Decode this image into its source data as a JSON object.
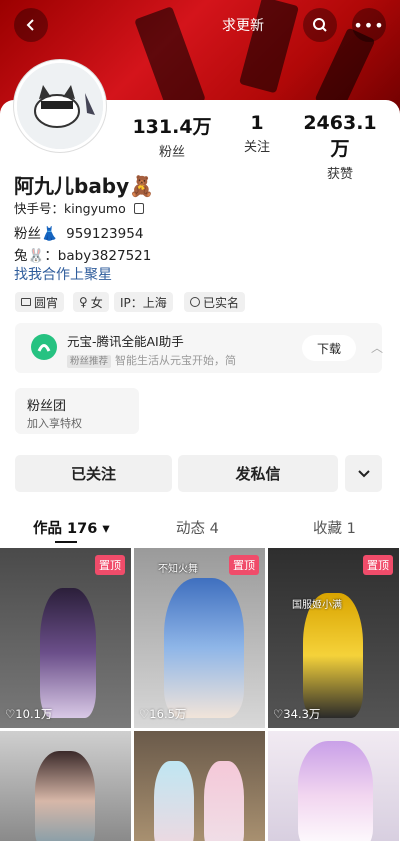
{
  "header": {
    "seek_update": "求更新"
  },
  "profile": {
    "name": "阿九儿baby",
    "name_emoji": "🧸",
    "kuaishou_id": "快手号：kingyumo",
    "fan_line_label": "粉丝",
    "fan_line_emoji": "👗",
    "fan_group_number": "959123954",
    "rabbit_label": "兔",
    "rabbit_emoji": "🐰",
    "rabbit_value": "：baby3827521",
    "collab_link": "找我合作上聚星"
  },
  "stats": [
    {
      "value": "131.4万",
      "label": "粉丝"
    },
    {
      "value": "1",
      "label": "关注"
    },
    {
      "value": "2463.1万",
      "label": "获赞"
    }
  ],
  "tags": [
    {
      "icon": "card-icon",
      "label": "圆宵"
    },
    {
      "icon": "female-icon",
      "label": "女"
    },
    {
      "icon": "ip-icon",
      "label": "IP：上海"
    },
    {
      "icon": "verified-icon",
      "label": "已实名"
    }
  ],
  "ad": {
    "title": "元宝-腾讯全能AI助手",
    "badge": "粉丝推荐",
    "subtitle": "智能生活从元宝开始，简",
    "download": "下载"
  },
  "fan_group": {
    "title": "粉丝团",
    "subtitle": "加入享特权"
  },
  "actions": {
    "followed": "已关注",
    "message": "发私信"
  },
  "tabs": [
    {
      "label": "作品 176 ▾"
    },
    {
      "label": "动态 4"
    },
    {
      "label": "收藏 1"
    }
  ],
  "grid": [
    {
      "pinned": "置顶",
      "likes": "♡10.1万",
      "caption": ""
    },
    {
      "pinned": "置顶",
      "likes": "♡16.5万",
      "caption": "不知火舞"
    },
    {
      "pinned": "置顶",
      "likes": "♡34.3万",
      "caption": "国服姬小满"
    },
    {
      "pinned": "",
      "likes": "",
      "caption": ""
    },
    {
      "pinned": "",
      "likes": "",
      "caption": ""
    },
    {
      "pinned": "",
      "likes": "",
      "caption": ""
    }
  ],
  "colors": {
    "banner": "#c8101a",
    "pin": "#f04c6a",
    "link": "#2f5d9c",
    "ad_logo": "#26c281"
  }
}
